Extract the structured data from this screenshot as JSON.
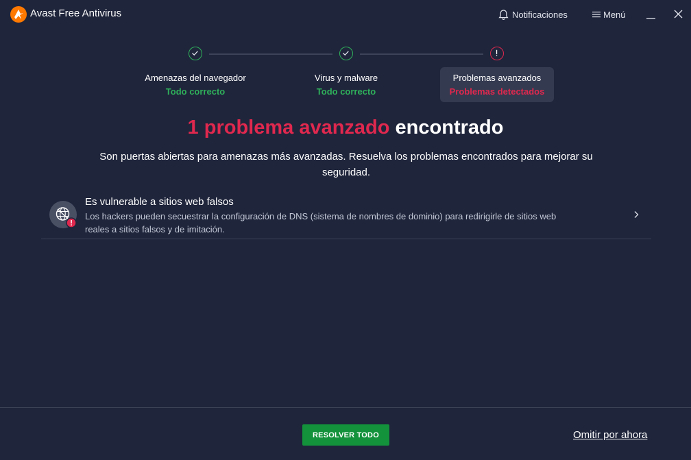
{
  "window": {
    "title": "Avast Free Antivirus",
    "notifications_label": "Notificaciones",
    "menu_label": "Menú"
  },
  "icons": {
    "logo": "avast-logo-icon",
    "notifications": "bell-icon",
    "menu": "hamburger-icon",
    "minimize": "minimize-icon",
    "close": "close-icon",
    "step_ok": "check-icon",
    "step_bad": "exclamation-icon",
    "issue": "globe-warning-icon",
    "chevron": "chevron-right-icon"
  },
  "colors": {
    "background": "#1f253b",
    "success": "#2fb05a",
    "danger": "#e0284e",
    "accent_orange": "#ff7800",
    "button_green": "#13913b"
  },
  "steps": [
    {
      "label": "Amenazas del navegador",
      "status": "Todo correcto",
      "state": "ok"
    },
    {
      "label": "Virus y malware",
      "status": "Todo correcto",
      "state": "ok"
    },
    {
      "label": "Problemas avanzados",
      "status": "Problemas detectados",
      "state": "problem"
    }
  ],
  "headline": {
    "highlight": "1 problema avanzado",
    "rest": "encontrado"
  },
  "subtitle": "Son puertas abiertas para amenazas más avanzadas. Resuelva los problemas encontrados para mejorar su seguridad.",
  "issues": [
    {
      "title": "Es vulnerable a sitios web falsos",
      "description": "Los hackers pueden secuestrar la configuración de DNS (sistema de nombres de dominio) para redirigirle de sitios web reales a sitios falsos y de imitación."
    }
  ],
  "footer": {
    "resolve_label": "RESOLVER TODO",
    "skip_label": "Omitir por ahora"
  }
}
